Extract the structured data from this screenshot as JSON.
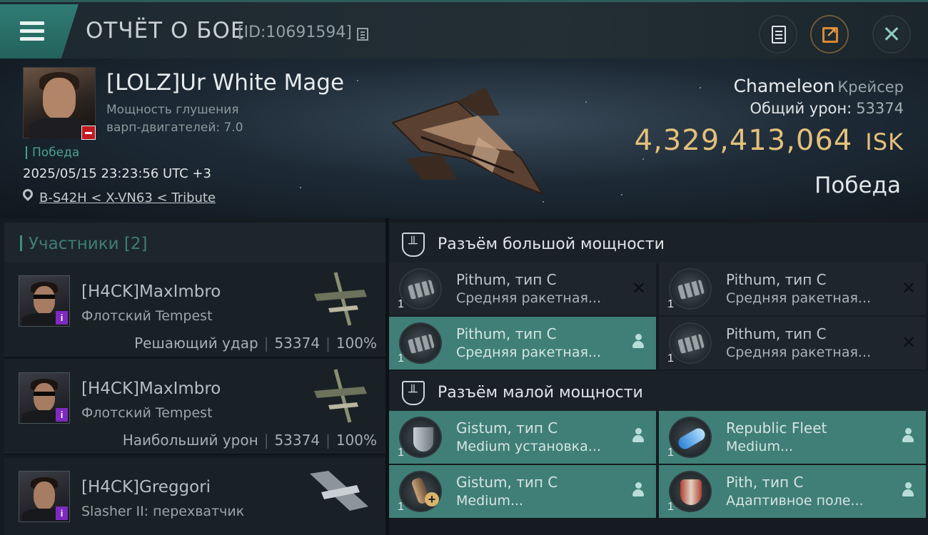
{
  "header": {
    "title": "ОТЧЁТ О БОЕ",
    "report_id": "[ID:10691594]",
    "menu_icon": "hamburger-menu-icon",
    "buttons": [
      "document-icon",
      "share-icon",
      "close-icon"
    ]
  },
  "victim": {
    "name": "[LOLZ]Ur White Mage",
    "stat_line1": "Мощность глушения",
    "stat_line2": "варп-двигателей: 7.0",
    "result_tag": "Победа",
    "datetime": "2025/05/15 23:23:56 UTC +3",
    "location": "B-S42H < X-VN63 < Tribute",
    "ship_name": "Chameleon",
    "ship_class": "Крейсер",
    "total_damage_label": "Общий урон:",
    "total_damage_value": "53374",
    "isk_value": "4,329,413,064",
    "isk_unit": "ISK",
    "outcome": "Победа"
  },
  "participants": {
    "header": "Участники [2]",
    "rows": [
      {
        "name": "[H4CK]MaxImbro",
        "ship": "Флотский Tempest",
        "role": "Решающий удар",
        "damage": "53374",
        "percent": "100%"
      },
      {
        "name": "[H4CK]MaxImbro",
        "ship": "Флотский Tempest",
        "role": "Наибольший урон",
        "damage": "53374",
        "percent": "100%"
      },
      {
        "name": "[H4CK]Greggori",
        "ship": "Slasher II: перехватчик",
        "role": "",
        "damage": "",
        "percent": ""
      }
    ]
  },
  "slots": {
    "high_title": "Разъём большой мощности",
    "low_title": "Разъём малой мощности",
    "high_items": [
      {
        "qty": "1",
        "name": "Pithum, тип C",
        "desc": "Средняя ракетная...",
        "status": "destroyed",
        "icon": "missile-launcher-icon"
      },
      {
        "qty": "1",
        "name": "Pithum, тип C",
        "desc": "Средняя ракетная...",
        "status": "destroyed",
        "icon": "missile-launcher-icon"
      },
      {
        "qty": "1",
        "name": "Pithum, тип C",
        "desc": "Средняя ракетная...",
        "status": "dropped",
        "icon": "missile-launcher-icon"
      },
      {
        "qty": "1",
        "name": "Pithum, тип C",
        "desc": "Средняя ракетная...",
        "status": "destroyed",
        "icon": "missile-launcher-icon"
      }
    ],
    "low_items": [
      {
        "qty": "1",
        "name": "Gistum, тип C",
        "desc": "Medium установка...",
        "status": "dropped",
        "icon": "shield-extender-icon"
      },
      {
        "qty": "1",
        "name": "Republic Fleet",
        "desc": "Medium...",
        "status": "dropped",
        "icon": "propulsion-module-icon"
      },
      {
        "qty": "1",
        "name": "Gistum, тип C",
        "desc": "Medium...",
        "status": "dropped",
        "icon": "shield-booster-icon"
      },
      {
        "qty": "1",
        "name": "Pith, тип C",
        "desc": "Адаптивное поле...",
        "status": "dropped",
        "icon": "adaptive-field-icon"
      }
    ]
  },
  "colors": {
    "accent": "#3f7f77",
    "isk": "#e3c07a",
    "loss_badge": "#c11a20",
    "corp_badge": "#7d2ac0"
  }
}
